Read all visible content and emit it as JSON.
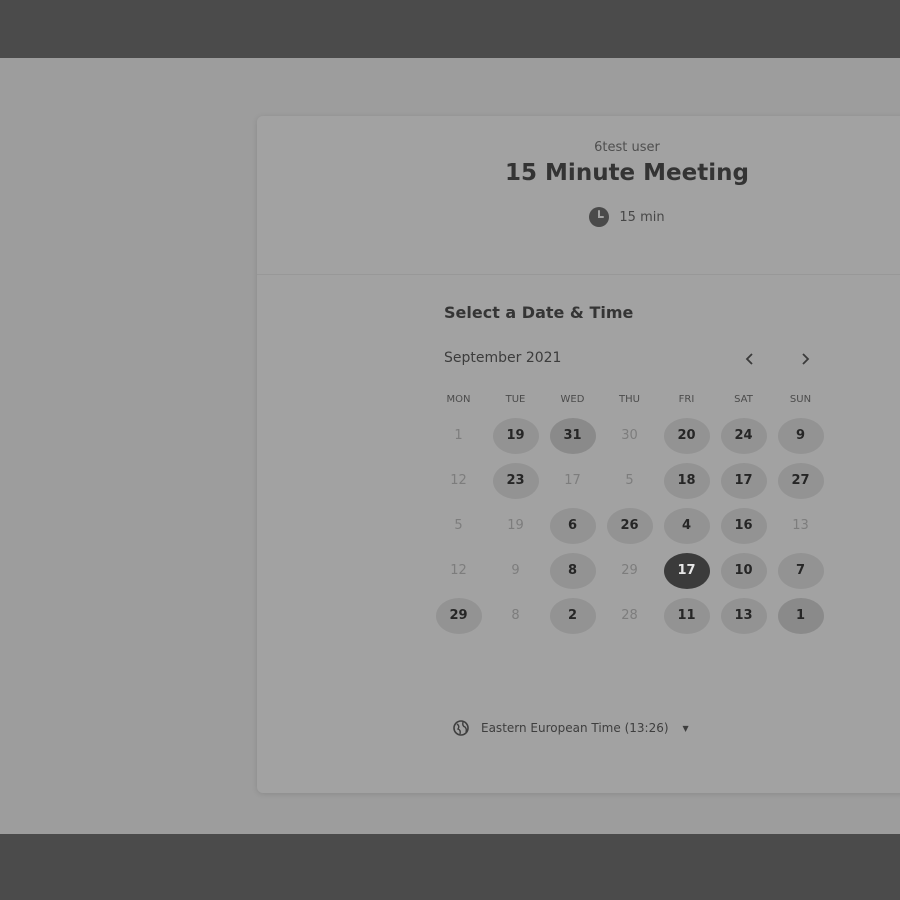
{
  "header": {
    "host_name": "6test user",
    "event_title": "15 Minute Meeting",
    "duration": "15 min"
  },
  "calendar": {
    "section_title": "Select a Date & Time",
    "month_label": "September 2021",
    "prev_icon": "chevron-left-icon",
    "next_icon": "chevron-right-icon",
    "weekdays": [
      "MON",
      "TUE",
      "WED",
      "THU",
      "FRI",
      "SAT",
      "SUN"
    ],
    "weeks": [
      [
        {
          "label": "1",
          "state": "unavailable"
        },
        {
          "label": "19",
          "state": "available"
        },
        {
          "label": "31",
          "state": "highlighted"
        },
        {
          "label": "30",
          "state": "unavailable"
        },
        {
          "label": "20",
          "state": "available"
        },
        {
          "label": "24",
          "state": "available"
        },
        {
          "label": "9",
          "state": "available"
        }
      ],
      [
        {
          "label": "12",
          "state": "unavailable"
        },
        {
          "label": "23",
          "state": "available"
        },
        {
          "label": "17",
          "state": "unavailable"
        },
        {
          "label": "5",
          "state": "unavailable"
        },
        {
          "label": "18",
          "state": "available"
        },
        {
          "label": "17",
          "state": "available"
        },
        {
          "label": "27",
          "state": "available"
        }
      ],
      [
        {
          "label": "5",
          "state": "unavailable"
        },
        {
          "label": "19",
          "state": "unavailable"
        },
        {
          "label": "6",
          "state": "available"
        },
        {
          "label": "26",
          "state": "available"
        },
        {
          "label": "4",
          "state": "available"
        },
        {
          "label": "16",
          "state": "available"
        },
        {
          "label": "13",
          "state": "unavailable"
        }
      ],
      [
        {
          "label": "12",
          "state": "unavailable"
        },
        {
          "label": "9",
          "state": "unavailable"
        },
        {
          "label": "8",
          "state": "available"
        },
        {
          "label": "29",
          "state": "unavailable"
        },
        {
          "label": "17",
          "state": "selected"
        },
        {
          "label": "10",
          "state": "available"
        },
        {
          "label": "7",
          "state": "available"
        }
      ],
      [
        {
          "label": "29",
          "state": "available"
        },
        {
          "label": "8",
          "state": "unavailable"
        },
        {
          "label": "2",
          "state": "available"
        },
        {
          "label": "28",
          "state": "unavailable"
        },
        {
          "label": "11",
          "state": "available"
        },
        {
          "label": "13",
          "state": "available"
        },
        {
          "label": "1",
          "state": "highlighted"
        }
      ]
    ]
  },
  "timezone": {
    "label": "Eastern European Time (13:26)",
    "icon": "globe-icon"
  },
  "icons": {
    "clock": "clock-icon",
    "caret": "caret-down-icon"
  }
}
